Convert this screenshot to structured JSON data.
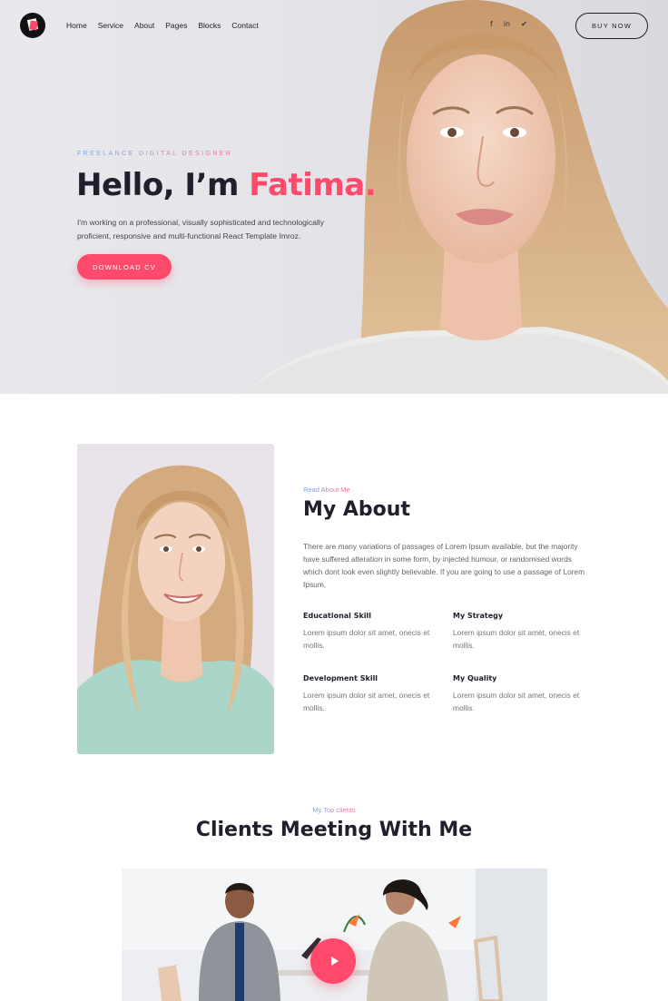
{
  "nav": {
    "items": [
      "Home",
      "Service",
      "About",
      "Pages",
      "Blocks",
      "Contact"
    ],
    "buy_label": "BUY NOW",
    "social_icons": [
      "facebook-icon",
      "linkedin-icon",
      "twitter-icon"
    ]
  },
  "hero": {
    "eyebrow": "FREELANCE DIGITAL DESIGNER",
    "title_prefix": "Hello, I’m ",
    "title_name": "Fatima.",
    "description": "I'm working on a professional, visually sophisticated and technologically proficient, responsive and multi-functional React Template Imroz.",
    "cta_label": "DOWNLOAD CV"
  },
  "about": {
    "eyebrow": "Read About Me",
    "title": "My About",
    "description": "There are many variations of passages of Lorem Ipsum available, but the majority have suffered alteration in some form, by injected humour, or randomised words which dont look even slightly believable. If you are going to use a passage of Lorem Ipsum,",
    "skills": [
      {
        "title": "Educational Skill",
        "text": "Lorem ipsum dolor sit amet, onecis et mollis."
      },
      {
        "title": "My Strategy",
        "text": "Lorem ipsum dolor sit amet, onecis et mollis."
      },
      {
        "title": "Development Skill",
        "text": "Lorem ipsum dolor sit amet, onecis et mollis."
      },
      {
        "title": "My Quality",
        "text": "Lorem ipsum dolor sit amet, onecis et mollis."
      }
    ]
  },
  "clients": {
    "eyebrow": "My Top clients",
    "title": "Clients Meeting With Me"
  },
  "colors": {
    "accent": "#ff4a6b",
    "heading": "#20202c",
    "gradient_start": "#6aa7f5",
    "gradient_end": "#ff6a8a"
  }
}
